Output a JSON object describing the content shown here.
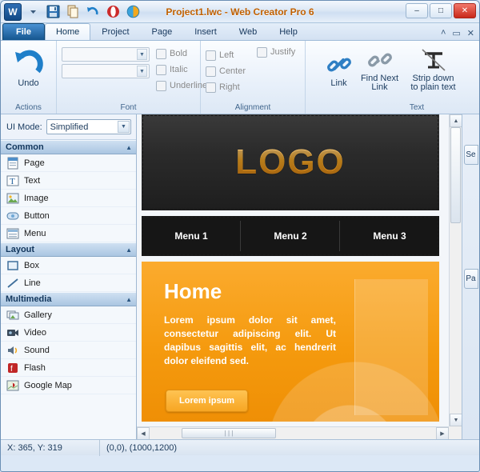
{
  "window": {
    "title": "Project1.lwc - Web Creator Pro 6",
    "app_logo": "W",
    "minimize": "–",
    "maximize": "□",
    "close": "✕"
  },
  "quick_access": [
    {
      "name": "save-icon",
      "glyph": "save"
    },
    {
      "name": "copy-icon",
      "glyph": "copy"
    },
    {
      "name": "undo-icon",
      "glyph": "undo"
    },
    {
      "name": "opera-icon",
      "glyph": "opera"
    },
    {
      "name": "preview-icon",
      "glyph": "preview"
    }
  ],
  "ribbon": {
    "tabs": [
      {
        "label": "File",
        "type": "file"
      },
      {
        "label": "Home",
        "type": "active"
      },
      {
        "label": "Project",
        "type": "normal"
      },
      {
        "label": "Page",
        "type": "normal"
      },
      {
        "label": "Insert",
        "type": "normal"
      },
      {
        "label": "Web",
        "type": "normal"
      },
      {
        "label": "Help",
        "type": "normal"
      }
    ],
    "tab_right_icons": [
      "˄",
      "▭",
      "✕"
    ],
    "groups": [
      {
        "label": "Actions",
        "buttons": [
          {
            "label": "Undo",
            "icon": "undo-arrow-icon"
          }
        ]
      },
      {
        "label": "Font",
        "combo_values": [
          "",
          ""
        ],
        "checks": [
          "Bold",
          "Italic",
          "Underline"
        ]
      },
      {
        "label": "Alignment",
        "checks_col1": [
          "Left",
          "Center",
          "Right"
        ],
        "checks_col2": [
          "Justify"
        ]
      },
      {
        "label": "Text",
        "buttons": [
          {
            "label": "Link",
            "icon": "chain-link-icon"
          },
          {
            "label": "Find Next\nLink",
            "icon": "broken-link-icon"
          },
          {
            "label": "Strip down\nto plain text",
            "icon": "strip-text-icon"
          }
        ]
      }
    ]
  },
  "left_panel": {
    "ui_mode_label": "UI Mode:",
    "ui_mode_value": "Simplified",
    "sections": [
      {
        "title": "Common",
        "items": [
          {
            "label": "Page",
            "icon": "page-icon"
          },
          {
            "label": "Text",
            "icon": "text-icon"
          },
          {
            "label": "Image",
            "icon": "image-icon"
          },
          {
            "label": "Button",
            "icon": "button-icon"
          },
          {
            "label": "Menu",
            "icon": "menu-icon"
          }
        ]
      },
      {
        "title": "Layout",
        "items": [
          {
            "label": "Box",
            "icon": "box-icon"
          },
          {
            "label": "Line",
            "icon": "line-icon"
          }
        ]
      },
      {
        "title": "Multimedia",
        "items": [
          {
            "label": "Gallery",
            "icon": "gallery-icon"
          },
          {
            "label": "Video",
            "icon": "video-icon"
          },
          {
            "label": "Sound",
            "icon": "sound-icon"
          },
          {
            "label": "Flash",
            "icon": "flash-icon"
          },
          {
            "label": "Google Map",
            "icon": "map-pin-icon"
          }
        ]
      }
    ]
  },
  "canvas": {
    "logo_text": "LOGO",
    "menu_items": [
      "Menu 1",
      "Menu 2",
      "Menu 3"
    ],
    "heading": "Home",
    "paragraph": "Lorem ipsum dolor sit amet, consectetur adipiscing elit. Ut dapibus sagittis elit, ac hendrerit dolor eleifend sed.",
    "button_label": "Lorem ipsum"
  },
  "right_dock": [
    {
      "label": "Se",
      "name": "site-manager-tab"
    },
    {
      "label": "Pa",
      "name": "page-properties-tab"
    }
  ],
  "status_bar": {
    "coords": "X: 365, Y: 319",
    "page_size": "(0,0), (1000,1200)"
  },
  "colors": {
    "accent_orange": "#f5a623",
    "title_orange": "#c06000",
    "header_blue": "#12365c",
    "dark_band": "#2b2b2b"
  }
}
